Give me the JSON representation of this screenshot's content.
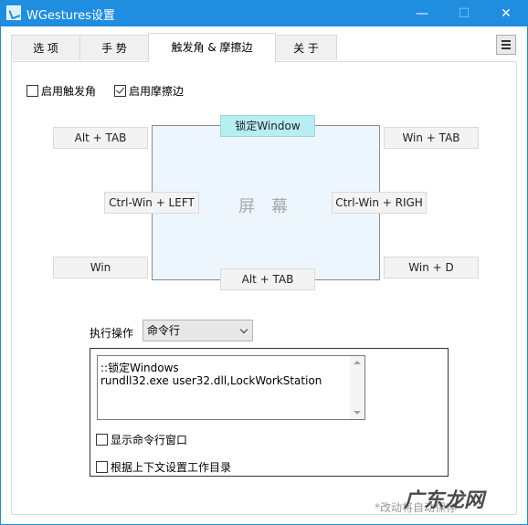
{
  "window": {
    "title": "WGestures设置",
    "min": "—",
    "max": "☐",
    "close": "✕"
  },
  "tabs": [
    {
      "label": "选 项"
    },
    {
      "label": "手 势"
    },
    {
      "label": "触发角 & 摩擦边"
    },
    {
      "label": "关 于"
    }
  ],
  "options": {
    "enable_corners": {
      "label": "启用触发角",
      "checked": false
    },
    "enable_edges": {
      "label": "启用摩擦边",
      "checked": true
    }
  },
  "screen": {
    "label": "屏 幕",
    "top_edge": "锁定Window",
    "top_left": "Alt + TAB",
    "top_right": "Win + TAB",
    "left_edge": "Ctrl-Win + LEFT",
    "right_edge": "Ctrl-Win  + RIGH",
    "bottom_left": "Win",
    "bottom_edge": "Alt + TAB",
    "bottom_right": "Win + D"
  },
  "action": {
    "label": "执行操作",
    "selected": "命令行",
    "command_lines": [
      "::锁定Windows",
      "rundll32.exe user32.dll,LockWorkStation"
    ],
    "show_window": {
      "label": "显示命令行窗口",
      "checked": false
    },
    "set_workdir": {
      "label": "根据上下文设置工作目录",
      "checked": false
    }
  },
  "footer": "*改动将自动保存",
  "watermark": "广东龙网",
  "colors": {
    "titlebar": "#1f8ee0",
    "highlight": "#b7eef3",
    "screen_bg": "#eef6fd"
  }
}
